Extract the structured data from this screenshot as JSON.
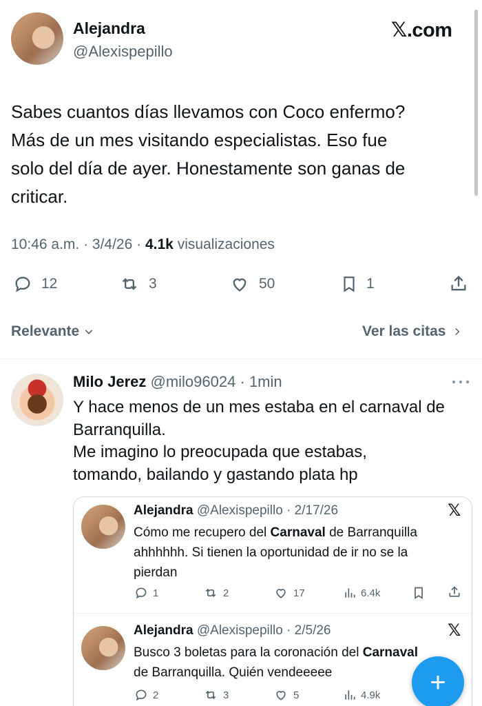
{
  "tweet": {
    "author_name": "Alejandra",
    "author_handle": "@Alexispepillo",
    "site_logo": "𝕏.com",
    "text_lines": [
      "Sabes cuantos días llevamos con Coco enfermo?",
      "Más de un mes visitando especialistas. Eso fue",
      "solo del día de ayer. Honestamente son ganas de",
      "criticar."
    ],
    "time": "10:46 a.m.",
    "date": "3/4/26",
    "views_count": "4.1k",
    "views_label": "visualizaciones",
    "stats": {
      "replies": "12",
      "reposts": "3",
      "likes": "50",
      "bookmarks": "1"
    }
  },
  "filters": {
    "sort_label": "Relevante",
    "quotes_link": "Ver las citas"
  },
  "reply": {
    "author_name": "Milo Jerez",
    "author_handle": "@milo96024",
    "time": "1min",
    "text_lines": [
      "Y hace menos de un mes estaba en el carnaval de",
      "Barranquilla.",
      "Me imagino lo preocupada que estabas,",
      "tomando, bailando y gastando plata hp"
    ],
    "quotes": [
      {
        "author_name": "Alejandra",
        "author_handle": "@Alexispepillo",
        "date": "2/17/26",
        "line1_pre": "Cómo me recupero del ",
        "line1_bold": "Carnaval",
        "line1_post": " de Barranquilla",
        "line2": "ahhhhhh. Si tienen la oportunidad de ir no se la",
        "line3": "pierdan",
        "stats": {
          "replies": "1",
          "reposts": "2",
          "likes": "17",
          "views": "6.4k"
        }
      },
      {
        "author_name": "Alejandra",
        "author_handle": "@Alexispepillo",
        "date": "2/5/26",
        "line1_pre": "Busco 3 boletas para la coronación del ",
        "line1_bold": "Carnaval",
        "line2": "de Barranquilla. Quién vendeeeee",
        "stats": {
          "replies": "2",
          "reposts": "3",
          "likes": "5",
          "views": "4.9k"
        }
      }
    ]
  },
  "fab": {
    "label": "+"
  },
  "colors": {
    "accent": "#1d9bf0",
    "muted": "#536471",
    "text": "#0f1419"
  }
}
